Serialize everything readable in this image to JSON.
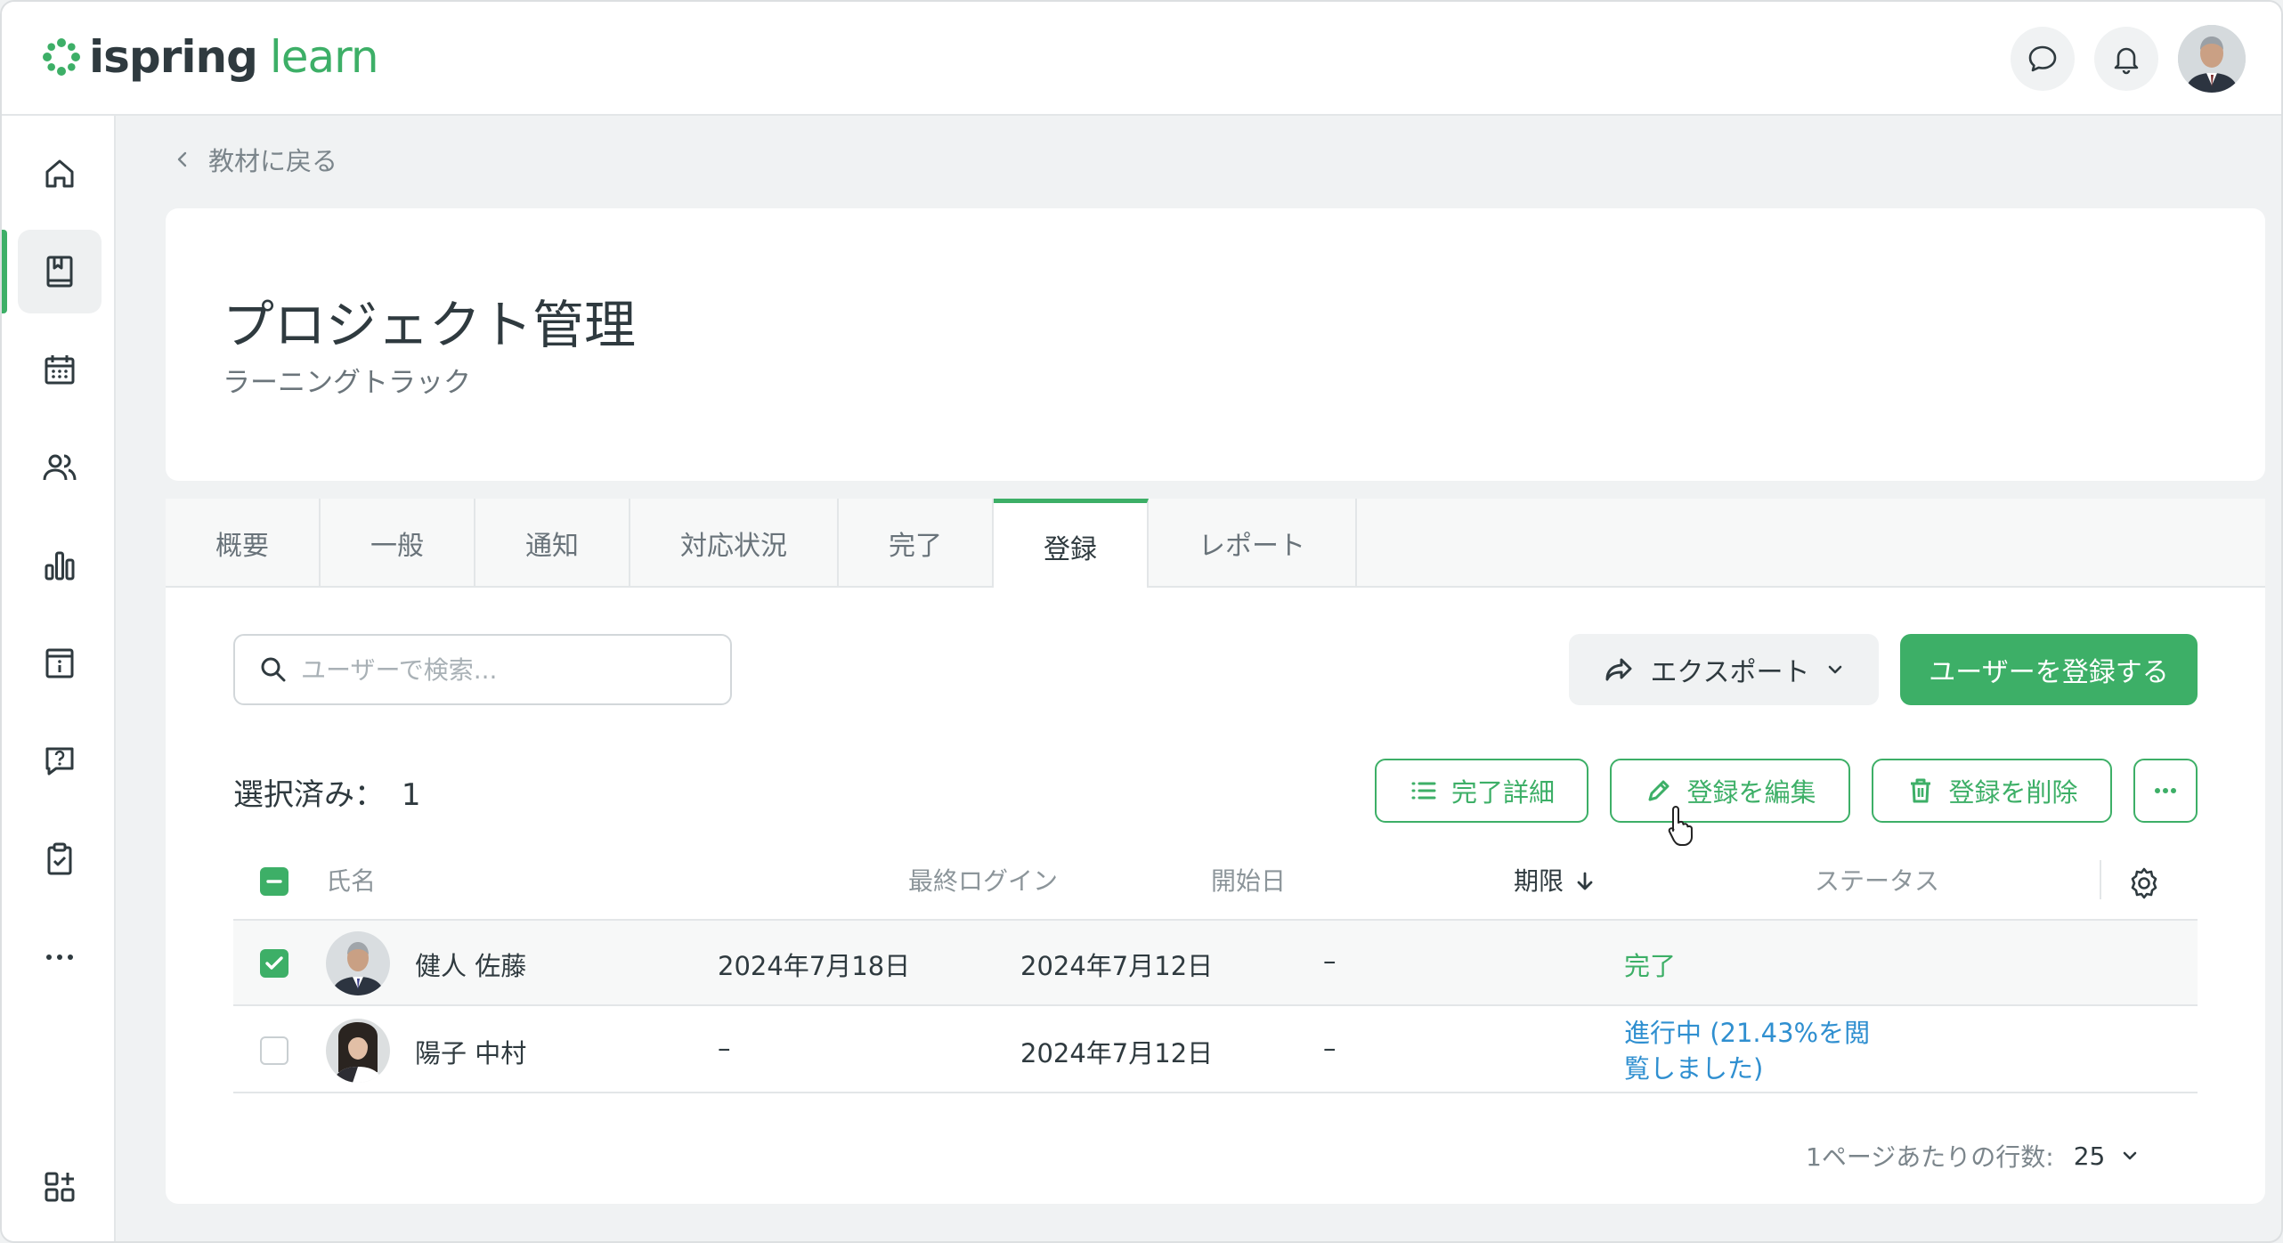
{
  "app": {
    "logo_primary": "ispring",
    "logo_secondary": "learn",
    "brand_color": "#3daf67",
    "link_color": "#2f8fd0"
  },
  "topbar": {
    "icons": [
      "chat-icon",
      "bell-icon",
      "avatar"
    ]
  },
  "sidebar": {
    "items": [
      {
        "name": "home-icon",
        "active": false
      },
      {
        "name": "book-icon",
        "active": true
      },
      {
        "name": "calendar-icon",
        "active": false
      },
      {
        "name": "users-icon",
        "active": false
      },
      {
        "name": "chart-icon",
        "active": false
      },
      {
        "name": "info-calendar-icon",
        "active": false
      },
      {
        "name": "question-chat-icon",
        "active": false
      },
      {
        "name": "clipboard-check-icon",
        "active": false
      },
      {
        "name": "more-dots-icon",
        "active": false
      },
      {
        "name": "add-widget-icon",
        "active": false
      }
    ]
  },
  "breadcrumb": {
    "back_label": "教材に戻る"
  },
  "course": {
    "title": "プロジェクト管理",
    "subtitle": "ラーニングトラック"
  },
  "tabs": [
    {
      "label": "概要",
      "active": false
    },
    {
      "label": "一般",
      "active": false
    },
    {
      "label": "通知",
      "active": false
    },
    {
      "label": "対応状況",
      "active": false
    },
    {
      "label": "完了",
      "active": false
    },
    {
      "label": "登録",
      "active": true
    },
    {
      "label": "レポート",
      "active": false
    }
  ],
  "toolbar": {
    "search_placeholder": "ユーザーで検索...",
    "export_label": "エクスポート",
    "register_label": "ユーザーを登録する"
  },
  "selection": {
    "label": "選択済み：",
    "count": "1"
  },
  "actions": {
    "completion_details": "完了詳細",
    "edit_enrollment": "登録を編集",
    "delete_enrollment": "登録を削除"
  },
  "table": {
    "columns": {
      "name": "氏名",
      "last_login": "最終ログイン",
      "start_date": "開始日",
      "due_date": "期限",
      "status": "ステータス"
    },
    "rows": [
      {
        "checked": true,
        "name": "健人 佐藤",
        "last_login": "2024年7月18日",
        "start_date": "2024年7月12日",
        "due_date": "–",
        "status": "完了",
        "status_type": "done"
      },
      {
        "checked": false,
        "name": "陽子 中村",
        "last_login": "–",
        "start_date": "2024年7月12日",
        "due_date": "–",
        "status": "進行中 (21.43%を閲覧しました)",
        "status_type": "progress"
      }
    ]
  },
  "pagination": {
    "rows_per_page_label": "1ページあたりの行数:",
    "rows_per_page_value": "25"
  }
}
